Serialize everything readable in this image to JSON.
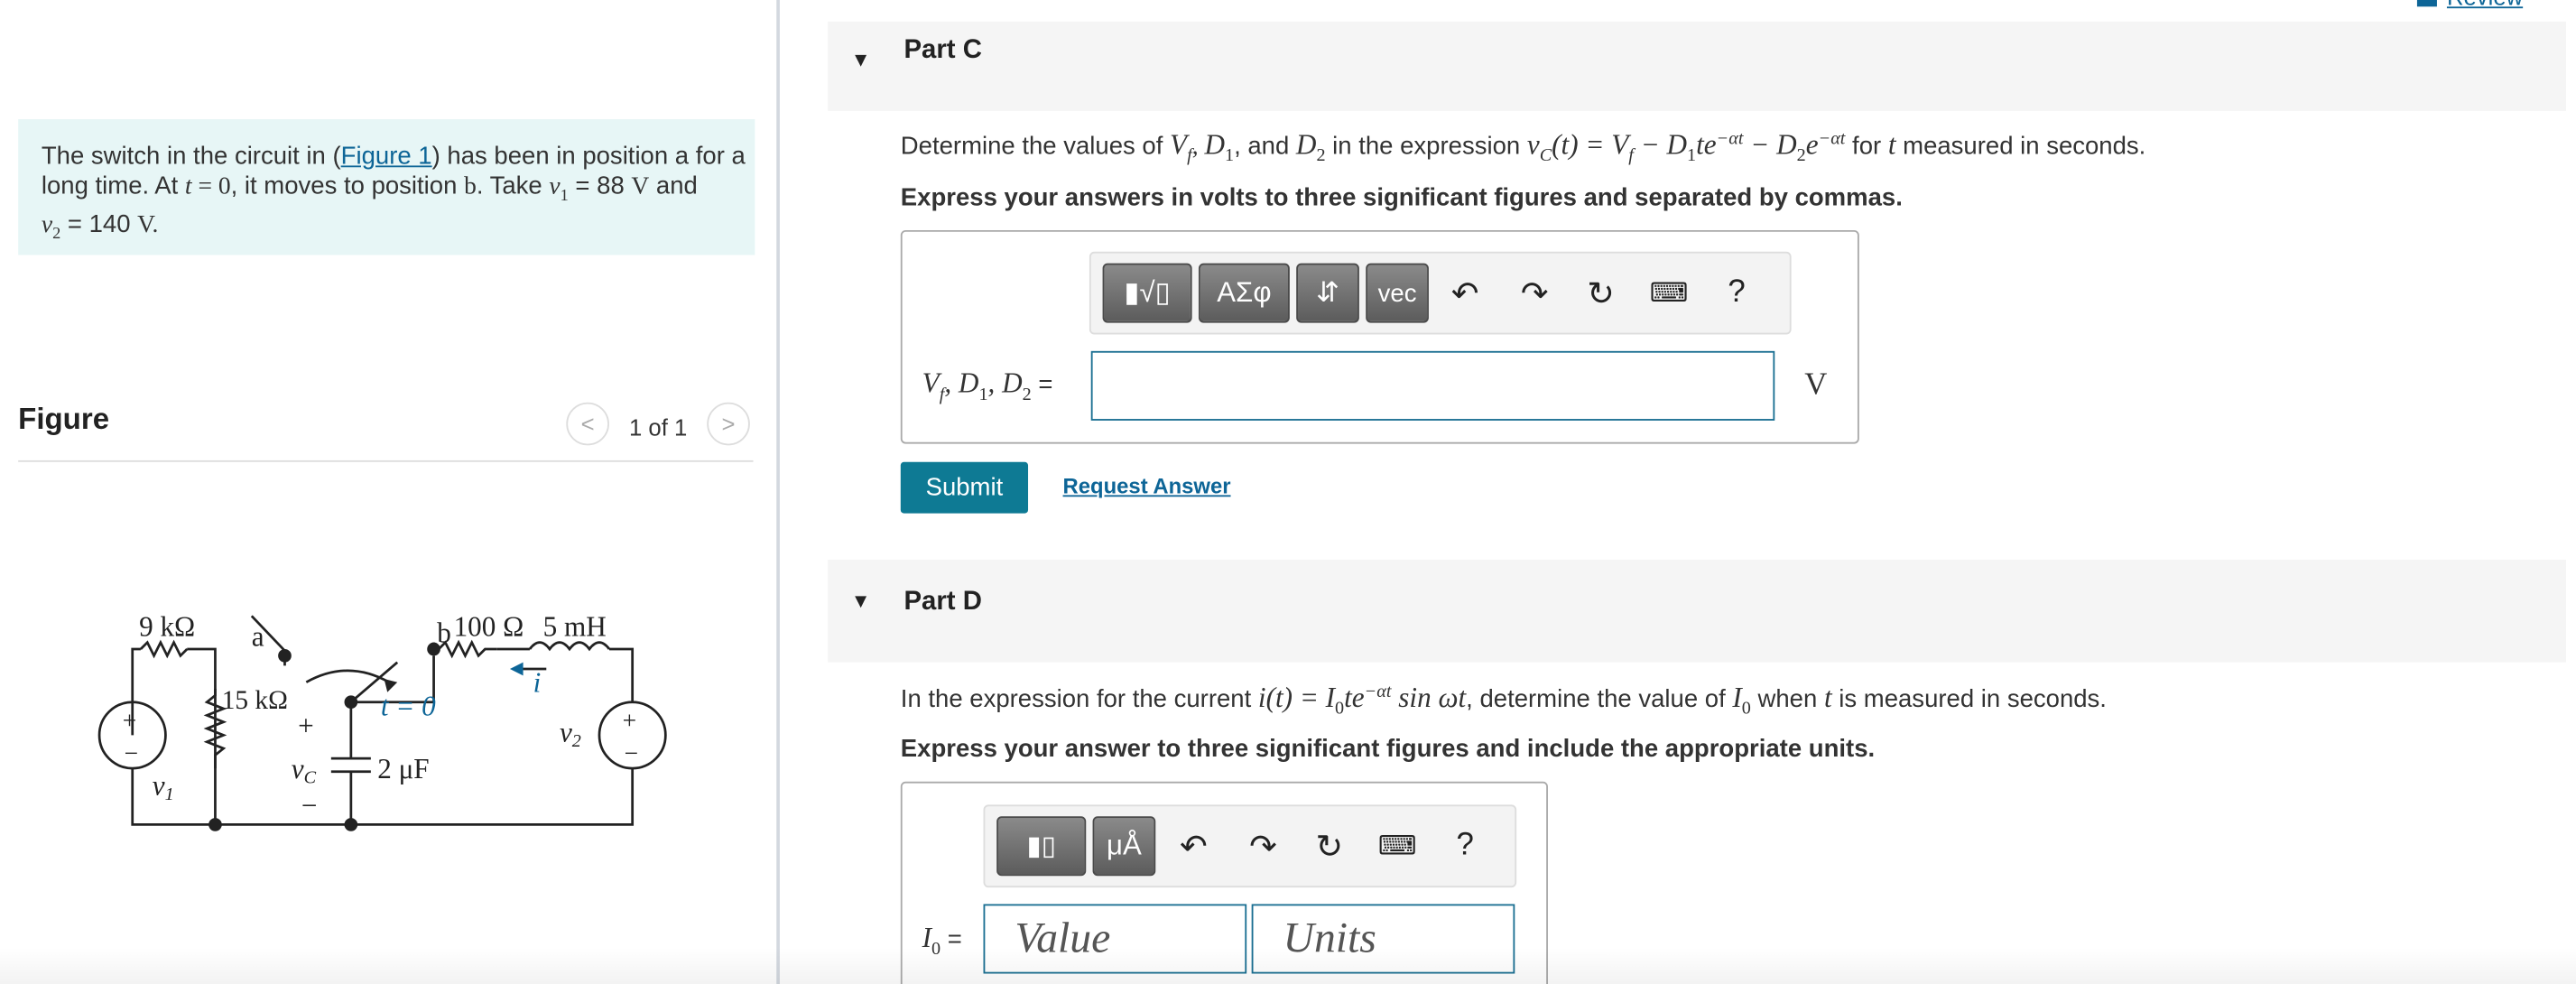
{
  "review": {
    "label": "Review"
  },
  "problem": {
    "line1_pre": "The switch in the circuit in (",
    "figure_link": "Figure 1",
    "line1_post": ") has been in position a for a",
    "line2_a": "long time. At ",
    "line2_t": "t",
    "line2_eq": " = 0",
    "line2_b": ", it moves to position ",
    "line2_pos": "b",
    "line2_c": ". Take ",
    "line2_v1": "v",
    "line2_v1sub": "1",
    "line2_v1val": " = 88 ",
    "line2_unit": "V",
    "line2_and": " and",
    "line3_v2": "v",
    "line3_v2sub": "2",
    "line3_val": " = 140 ",
    "line3_unit": "V."
  },
  "figure": {
    "title": "Figure",
    "counter": "1 of 1",
    "prev_icon": "chevron-left-icon",
    "next_icon": "chevron-right-icon",
    "labels": {
      "r1": "9 kΩ",
      "a": "a",
      "b": "b",
      "r3": "100 Ω",
      "l": "5 mH",
      "i": "i",
      "r2": "15 kΩ",
      "plus_c": "+",
      "t0": "t = 0",
      "vc": "v",
      "vc_sub": "C",
      "cap": "2 μF",
      "minus_c": "−",
      "v1": "v",
      "v1_sub": "1",
      "v2": "v",
      "v2_sub": "2",
      "src_plus": "+",
      "src_minus": "−"
    }
  },
  "partC": {
    "title": "Part C",
    "question_pre": "Determine the values of ",
    "question_vars": "V",
    "question_vars_sub": "f",
    "question_d1": "D",
    "question_d1_sub": "1",
    "question_and": ", and ",
    "question_d2": "D",
    "question_d2_sub": "2",
    "question_mid": " in the expression ",
    "question_expr": "v",
    "question_expr_sub": "C",
    "question_expr_rest": "(t) = V",
    "question_vf_sub": "f",
    "question_minus1": " − D",
    "question_d1b_sub": "1",
    "question_te": "te",
    "question_exp1": "−αt",
    "question_minus2": " − D",
    "question_d2b_sub": "2",
    "question_e": "e",
    "question_exp2": "−αt",
    "question_for": " for ",
    "question_t": "t",
    "question_post": " measured in seconds.",
    "instruction": "Express your answers in volts to three significant figures and separated by commas.",
    "toolbar": {
      "templates_icon": "templates-icon",
      "greek": "ΑΣφ",
      "arrows": "⇵",
      "vec": "vec",
      "undo_icon": "undo-icon",
      "redo_icon": "redo-icon",
      "reset_icon": "reset-icon",
      "keyboard_icon": "keyboard-icon",
      "help": "?"
    },
    "input_label": "V",
    "input_label_f": "f",
    "input_label_rest": ", D",
    "input_label_1": "1",
    "input_label_rest2": ", D",
    "input_label_2": "2",
    "input_label_eq": " =",
    "input_value": "",
    "unit": "V",
    "submit": "Submit",
    "request_answer": "Request Answer"
  },
  "partD": {
    "title": "Part D",
    "q_pre": "In the expression for the current ",
    "q_i": "i",
    "q_expr": "(t) = I",
    "q_sub0": "0",
    "q_te": "te",
    "q_exp": "−αt",
    "q_sin": " sin ωt",
    "q_mid": ", determine the value of ",
    "q_I": "I",
    "q_I0": "0",
    "q_when": " when ",
    "q_t": "t",
    "q_post": " is measured in seconds.",
    "instruction": "Express your answer to three significant figures and include the appropriate units.",
    "toolbar": {
      "templates_icon": "templates-icon",
      "units": "μÅ",
      "undo_icon": "undo-icon",
      "redo_icon": "redo-icon",
      "reset_icon": "reset-icon",
      "keyboard_icon": "keyboard-icon",
      "help": "?"
    },
    "input_label": "I",
    "input_label_sub": "0",
    "input_label_eq": " =",
    "value_placeholder": "Value",
    "units_placeholder": "Units"
  }
}
